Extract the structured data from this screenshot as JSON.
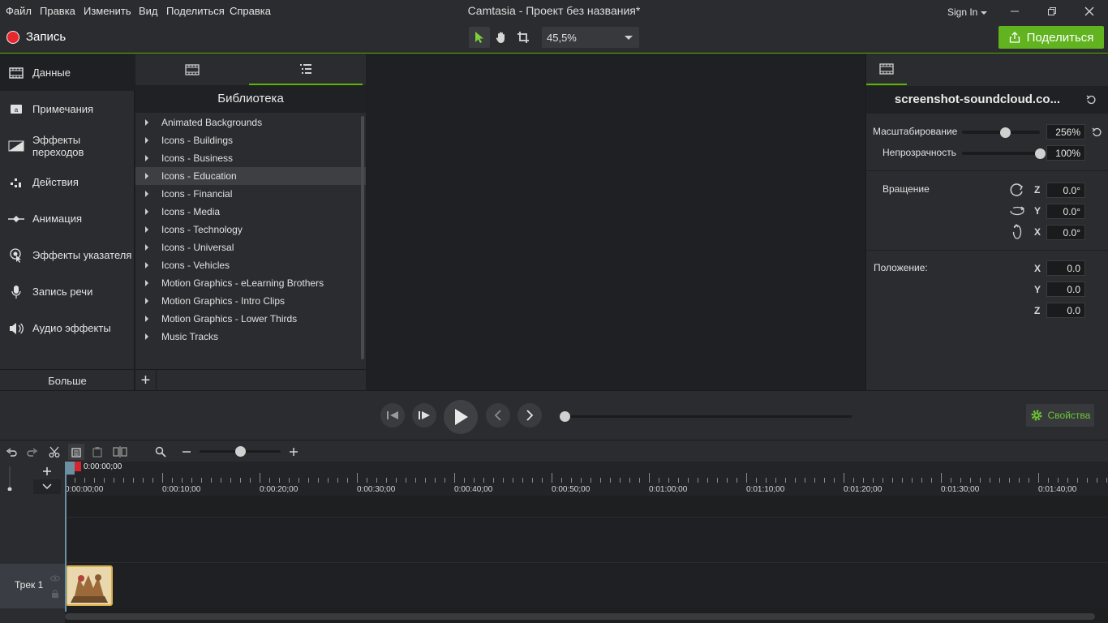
{
  "menu": [
    "Файл",
    "Правка",
    "Изменить",
    "Вид",
    "Поделиться",
    "Справка"
  ],
  "app_title": "Camtasia - Проект без названия*",
  "sign_in": "Sign In",
  "toolbar": {
    "record_label": "Запись",
    "zoom_value": "45,5%",
    "share_label": "Поделиться"
  },
  "colors": {
    "accent": "#5bb600",
    "share_bg": "#61b31f",
    "record": "#e8262d",
    "clip_border": "#d9b24a"
  },
  "sidebar": {
    "items": [
      {
        "label": "Данные",
        "icon": "film-icon"
      },
      {
        "label": "Примечания",
        "icon": "annotation-icon"
      },
      {
        "label": "Эффекты переходов",
        "icon": "transition-icon"
      },
      {
        "label": "Действия",
        "icon": "behaviors-icon"
      },
      {
        "label": "Анимация",
        "icon": "animation-icon"
      },
      {
        "label": "Эффекты указателя",
        "icon": "cursor-effects-icon"
      },
      {
        "label": "Запись речи",
        "icon": "microphone-icon"
      },
      {
        "label": "Аудио эффекты",
        "icon": "speaker-icon"
      }
    ],
    "more_label": "Больше"
  },
  "library": {
    "title": "Библиотека",
    "items": [
      "Animated Backgrounds",
      "Icons - Buildings",
      "Icons - Business",
      "Icons - Education",
      "Icons - Financial",
      "Icons - Media",
      "Icons - Technology",
      "Icons - Universal",
      "Icons - Vehicles",
      "Motion Graphics - eLearning Brothers",
      "Motion Graphics - Intro Clips",
      "Motion Graphics - Lower Thirds",
      "Music Tracks"
    ],
    "selected_index": 3,
    "add_label": "+"
  },
  "properties": {
    "title": "screenshot-soundcloud.co...",
    "scale_label": "Масштабирование",
    "scale_value": "256%",
    "scale_level": 0.55,
    "opacity_label": "Непрозрачность",
    "opacity_value": "100%",
    "opacity_level": 1.0,
    "rotation_label": "Вращение",
    "rotation": {
      "z": "0.0°",
      "y": "0.0°",
      "x": "0.0°"
    },
    "position_label": "Положение:",
    "position": {
      "x": "0.0",
      "y": "0.0",
      "z": "0.0"
    },
    "axes": {
      "x": "X",
      "y": "Y",
      "z": "Z"
    }
  },
  "playback": {
    "properties_label": "Свойства",
    "progress": 0.0
  },
  "timeline": {
    "playhead_time": "0:00:00;00",
    "ticks": [
      "0:00:00;00",
      "0:00:10;00",
      "0:00:20;00",
      "0:00:30;00",
      "0:00:40;00",
      "0:00:50;00",
      "0:01:00;00",
      "0:01:10;00",
      "0:01:20;00",
      "0:01:30;00",
      "0:01:40;00"
    ],
    "track_label": "Трек 1",
    "zoom_level": 0.5
  }
}
